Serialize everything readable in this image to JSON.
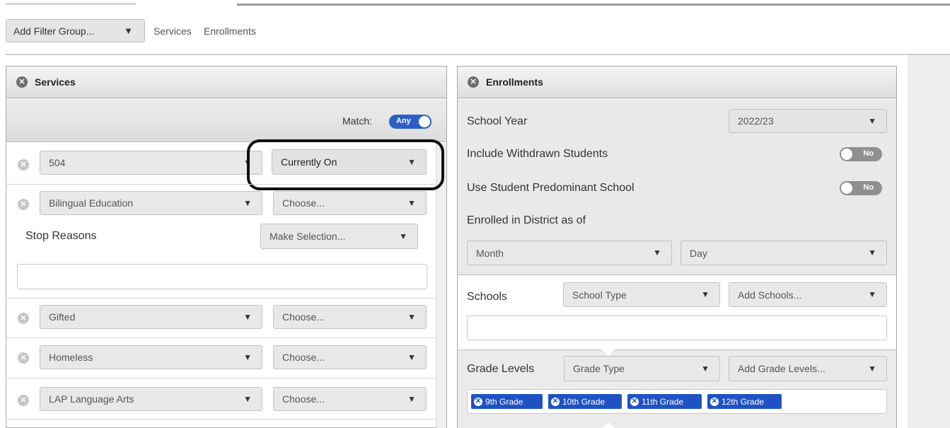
{
  "filter_bar": {
    "add_filter_label": "Add Filter Group...",
    "links": [
      "Services",
      "Enrollments"
    ]
  },
  "services_panel": {
    "title": "Services",
    "match_label": "Match:",
    "match_toggle": "Any",
    "rows": [
      {
        "service": "504",
        "status": "Currently On"
      },
      {
        "service": "Bilingual Education",
        "status": "Choose..."
      },
      {
        "service": "Gifted",
        "status": "Choose..."
      },
      {
        "service": "Homeless",
        "status": "Choose..."
      },
      {
        "service": "LAP Language Arts",
        "status": "Choose..."
      }
    ],
    "stop_reasons_label": "Stop Reasons",
    "stop_reasons_select": "Make Selection..."
  },
  "enrollments_panel": {
    "title": "Enrollments",
    "school_year_label": "School Year",
    "school_year_value": "2022/23",
    "include_withdrawn_label": "Include Withdrawn Students",
    "include_withdrawn_toggle": "No",
    "predominant_label": "Use Student Predominant School",
    "predominant_toggle": "No",
    "enrolled_as_of_label": "Enrolled in District as of",
    "month_placeholder": "Month",
    "day_placeholder": "Day",
    "schools_label": "Schools",
    "school_type_select": "School Type",
    "add_schools_select": "Add Schools...",
    "grade_levels_label": "Grade Levels",
    "grade_type_select": "Grade Type",
    "add_grade_levels_select": "Add Grade Levels...",
    "grade_chips": [
      "9th Grade",
      "10th Grade",
      "11th Grade",
      "12th Grade"
    ]
  },
  "colors": {
    "accent": "#1f53c4",
    "callout": "#111111"
  }
}
